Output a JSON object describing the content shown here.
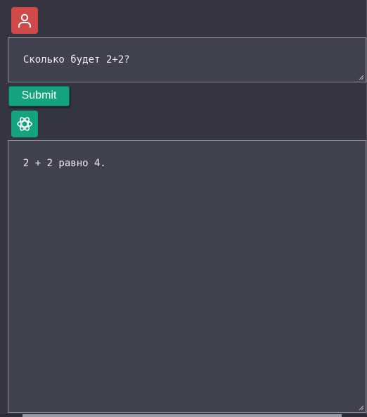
{
  "chat": {
    "user_message": "Сколько будет 2+2?",
    "submit_label": "Submit",
    "assistant_message": "2 + 2 равно 4."
  },
  "icons": {
    "user_avatar": "user-icon",
    "assistant_avatar": "openai-logo-icon"
  },
  "colors": {
    "background": "#343541",
    "textbox_background": "#40414f",
    "user_avatar": "#d04a4a",
    "assistant_avatar": "#13a37f",
    "submit_button": "#13a37f",
    "text": "#ececf1"
  }
}
